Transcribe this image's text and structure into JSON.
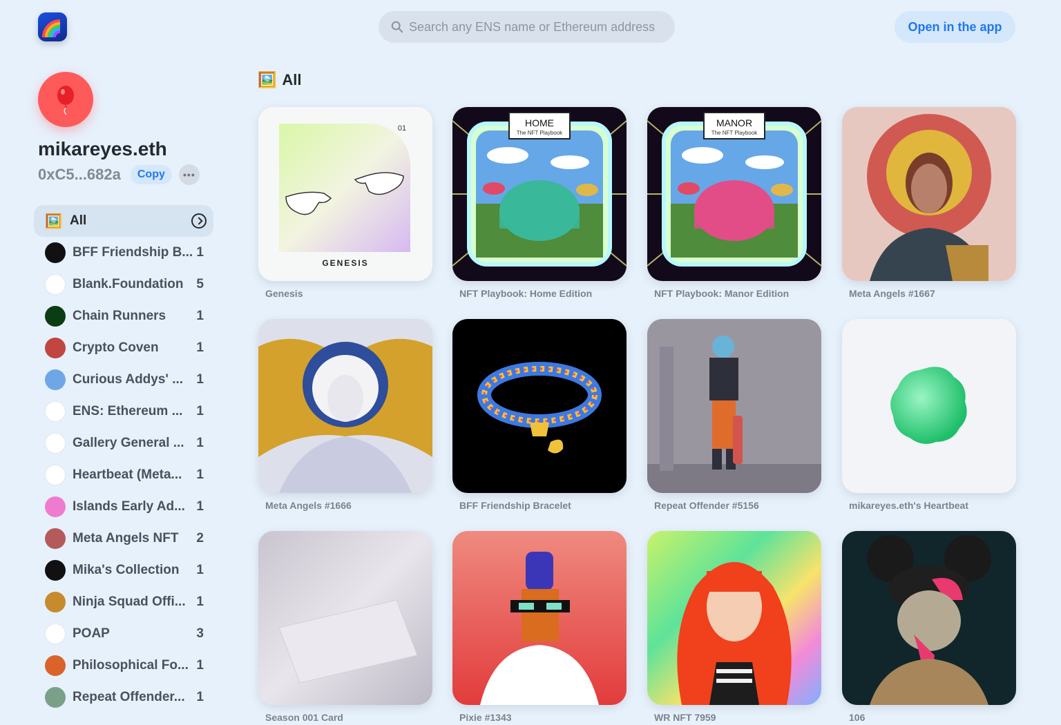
{
  "header": {
    "search_placeholder": "Search any ENS name or Ethereum address",
    "open_app_label": "Open in the app"
  },
  "profile": {
    "name": "mikareyes.eth",
    "address": "0xC5...682a",
    "copy_label": "Copy",
    "more_label": "•••"
  },
  "sidebar": {
    "all_label": "All",
    "items": [
      {
        "label": "BFF Friendship B...",
        "count": "1",
        "icon": "bff-icon",
        "color": "#111111"
      },
      {
        "label": "Blank.Foundation",
        "count": "5",
        "icon": "blank-icon",
        "color": "#ffffff"
      },
      {
        "label": "Chain Runners",
        "count": "1",
        "icon": "chain-runners-icon",
        "color": "#0b3d12"
      },
      {
        "label": "Crypto Coven",
        "count": "1",
        "icon": "crypto-coven-icon",
        "color": "#c0463f"
      },
      {
        "label": "Curious Addys' ...",
        "count": "1",
        "icon": "curious-addys-icon",
        "color": "#6fa6e8"
      },
      {
        "label": "ENS: Ethereum ...",
        "count": "1",
        "icon": "ens-icon",
        "color": "#ffffff"
      },
      {
        "label": "Gallery General ...",
        "count": "1",
        "icon": "gallery-icon",
        "color": "#ffffff"
      },
      {
        "label": "Heartbeat (Meta...",
        "count": "1",
        "icon": "heartbeat-icon",
        "color": "#ffffff"
      },
      {
        "label": "Islands Early Ad...",
        "count": "1",
        "icon": "islands-icon",
        "color": "#ef7bd1"
      },
      {
        "label": "Meta Angels NFT",
        "count": "2",
        "icon": "meta-angels-icon",
        "color": "#b55a5a"
      },
      {
        "label": "Mika's Collection",
        "count": "1",
        "icon": "mikas-collection-icon",
        "color": "#111111"
      },
      {
        "label": "Ninja Squad Offi...",
        "count": "1",
        "icon": "ninja-squad-icon",
        "color": "#c78a2d"
      },
      {
        "label": "POAP",
        "count": "3",
        "icon": "poap-icon",
        "color": "#ffffff"
      },
      {
        "label": "Philosophical Fo...",
        "count": "1",
        "icon": "philosophical-icon",
        "color": "#d9632a"
      },
      {
        "label": "Repeat Offender...",
        "count": "1",
        "icon": "repeat-offender-icon",
        "color": "#7aa08a"
      }
    ]
  },
  "main": {
    "section_title": "All",
    "cards": [
      {
        "caption": "Genesis",
        "thumb": "genesis",
        "inner_text": "GENESIS",
        "number": "01"
      },
      {
        "caption": "NFT Playbook: Home Edition",
        "thumb": "playbook-home",
        "sign_title": "HOME",
        "sign_sub": "The NFT Playbook"
      },
      {
        "caption": "NFT Playbook: Manor Edition",
        "thumb": "playbook-manor",
        "sign_title": "MANOR",
        "sign_sub": "The NFT Playbook"
      },
      {
        "caption": "Meta Angels #1667",
        "thumb": "meta-angels-1667"
      },
      {
        "caption": "Meta Angels #1666",
        "thumb": "meta-angels-1666"
      },
      {
        "caption": "BFF Friendship Bracelet",
        "thumb": "bff-bracelet"
      },
      {
        "caption": "Repeat Offender #5156",
        "thumb": "repeat-offender"
      },
      {
        "caption": "mikareyes.eth's Heartbeat",
        "thumb": "heartbeat"
      },
      {
        "caption": "Season 001 Card",
        "thumb": "season-card"
      },
      {
        "caption": "Pixie #1343",
        "thumb": "pixie"
      },
      {
        "caption": "WR NFT 7959",
        "thumb": "wr-nft"
      },
      {
        "caption": "106",
        "thumb": "nft-106"
      }
    ]
  }
}
